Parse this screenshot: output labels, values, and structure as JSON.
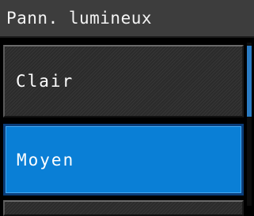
{
  "header": {
    "title": "Pann. lumineux"
  },
  "menu": {
    "items": [
      {
        "label": "Clair",
        "selected": false
      },
      {
        "label": "Moyen",
        "selected": true
      },
      {
        "label": "",
        "selected": false
      }
    ]
  },
  "colors": {
    "selected_fill": "#0a7fd6",
    "item_fill": "#2b2b2b",
    "header_fill": "#3d3d3d"
  }
}
